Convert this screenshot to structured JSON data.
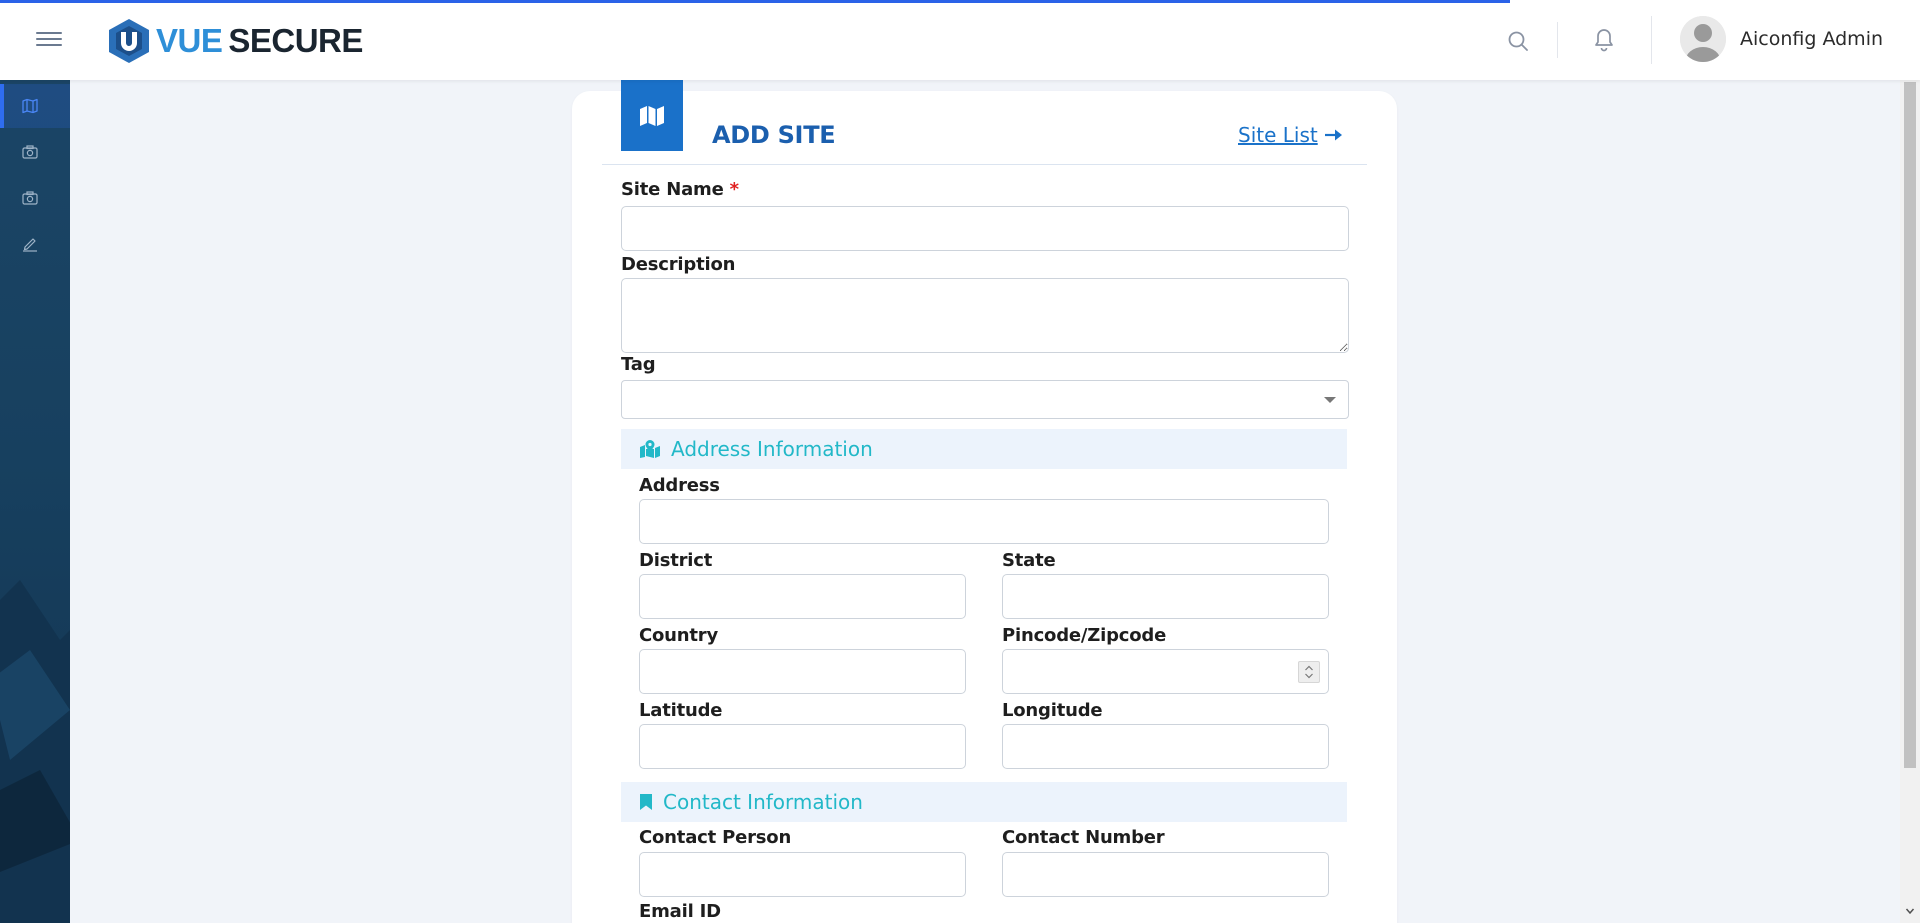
{
  "app": {
    "brand_left": "VUE",
    "brand_right": "SECURE",
    "user_name": "Aiconfig Admin"
  },
  "icons": {
    "menu": "hamburger-icon",
    "search": "search-icon",
    "notifications": "bell-icon",
    "avatar": "user-avatar-icon",
    "sidebar": [
      "map-icon",
      "camera-icon",
      "camera-icon",
      "edit-icon"
    ],
    "card": "map-icon",
    "site_list": "arrow-right-icon",
    "address_section": "map-marked-icon",
    "contact_section": "bookmark-icon"
  },
  "colors": {
    "accent": "#1a71c9",
    "title": "#1b5fae",
    "section_text": "#22b8c8",
    "required": "#e02020",
    "sidebar_bg": "#17405f"
  },
  "form": {
    "title": "ADD SITE",
    "site_list_link": "Site List",
    "site_name_label": "Site Name",
    "required_mark": "*",
    "description_label": "Description",
    "tag_label": "Tag",
    "address_section_title": "Address Information",
    "address_label": "Address",
    "district_label": "District",
    "state_label": "State",
    "country_label": "Country",
    "pincode_label": "Pincode/Zipcode",
    "latitude_label": "Latitude",
    "longitude_label": "Longitude",
    "contact_section_title": "Contact Information",
    "contact_person_label": "Contact Person",
    "contact_number_label": "Contact Number",
    "email_label": "Email ID"
  }
}
